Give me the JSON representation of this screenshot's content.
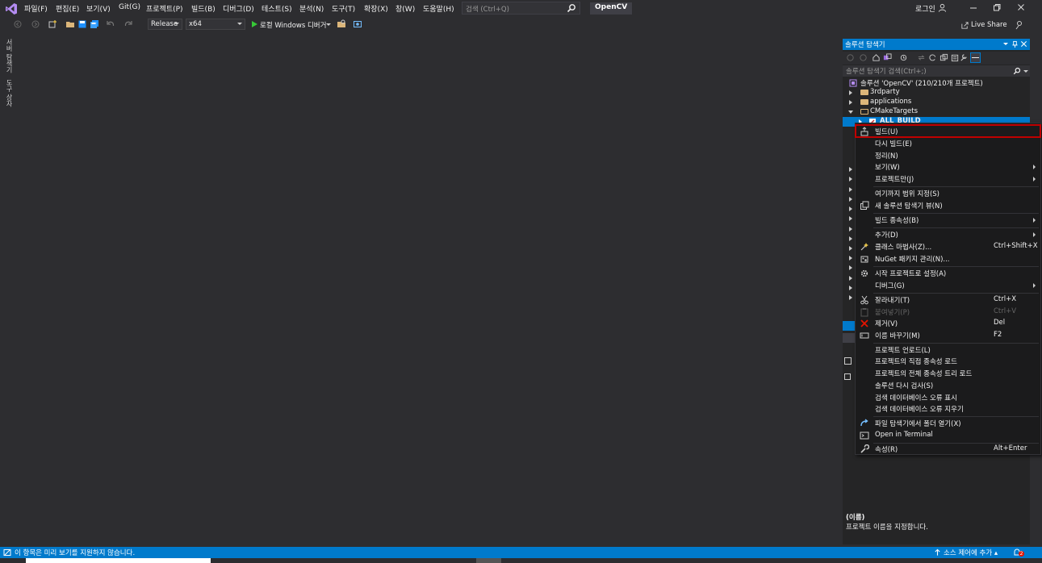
{
  "menu": {
    "items": [
      "파일(F)",
      "편집(E)",
      "보기(V)",
      "Git(G)",
      "프로젝트(P)",
      "빌드(B)",
      "디버그(D)",
      "테스트(S)",
      "분석(N)",
      "도구(T)",
      "확장(X)",
      "창(W)",
      "도움말(H)"
    ],
    "search_placeholder": "검색 (Ctrl+Q)",
    "solution_name": "OpenCV",
    "login": "로그인"
  },
  "toolbar": {
    "configuration": "Release",
    "platform": "x64",
    "debugger": "로컬 Windows 디버거",
    "live_share": "Live Share"
  },
  "left_tabs": [
    "서버 탐색기",
    "도구 상자"
  ],
  "solution_explorer": {
    "title": "솔루션 탐색기",
    "search_placeholder": "솔루션 탐색기 검색(Ctrl+;)",
    "tree": {
      "solution": "솔루션 'OpenCV' (210/210개 프로젝트)",
      "items": [
        "3rdparty",
        "applications",
        "CMakeTargets",
        "ALL_BUILD"
      ]
    }
  },
  "properties": {
    "description_title": "(이름)",
    "description": "프로젝트 이름을 지정합니다."
  },
  "context_menu": {
    "items": [
      {
        "label": "빌드(U)",
        "shortcut": "",
        "submenu": false,
        "disabled": false,
        "icon": "build-icon"
      },
      {
        "label": "다시 빌드(E)",
        "shortcut": "",
        "submenu": false,
        "disabled": false,
        "icon": ""
      },
      {
        "label": "정리(N)",
        "shortcut": "",
        "submenu": false,
        "disabled": false,
        "icon": ""
      },
      {
        "label": "보기(W)",
        "shortcut": "",
        "submenu": true,
        "disabled": false,
        "icon": ""
      },
      {
        "label": "프로젝트만(J)",
        "shortcut": "",
        "submenu": true,
        "disabled": false,
        "icon": ""
      },
      {
        "label": "여기까지 범위 지정(S)",
        "shortcut": "",
        "submenu": false,
        "disabled": false,
        "icon": ""
      },
      {
        "label": "새 솔루션 탐색기 뷰(N)",
        "shortcut": "",
        "submenu": false,
        "disabled": false,
        "icon": "new-view-icon"
      },
      {
        "label": "빌드 종속성(B)",
        "shortcut": "",
        "submenu": true,
        "disabled": false,
        "icon": ""
      },
      {
        "label": "추가(D)",
        "shortcut": "",
        "submenu": true,
        "disabled": false,
        "icon": ""
      },
      {
        "label": "클래스 마법사(Z)...",
        "shortcut": "Ctrl+Shift+X",
        "submenu": false,
        "disabled": false,
        "icon": "class-wizard-icon"
      },
      {
        "label": "NuGet 패키지 관리(N)...",
        "shortcut": "",
        "submenu": false,
        "disabled": false,
        "icon": "nuget-icon"
      },
      {
        "label": "시작 프로젝트로 설정(A)",
        "shortcut": "",
        "submenu": false,
        "disabled": false,
        "icon": "gear-icon"
      },
      {
        "label": "디버그(G)",
        "shortcut": "",
        "submenu": true,
        "disabled": false,
        "icon": ""
      },
      {
        "label": "잘라내기(T)",
        "shortcut": "Ctrl+X",
        "submenu": false,
        "disabled": false,
        "icon": "scissors-icon"
      },
      {
        "label": "붙여넣기(P)",
        "shortcut": "Ctrl+V",
        "submenu": false,
        "disabled": true,
        "icon": "paste-icon"
      },
      {
        "label": "제거(V)",
        "shortcut": "Del",
        "submenu": false,
        "disabled": false,
        "icon": "remove-icon"
      },
      {
        "label": "이름 바꾸기(M)",
        "shortcut": "F2",
        "submenu": false,
        "disabled": false,
        "icon": "rename-icon"
      },
      {
        "label": "프로젝트 언로드(L)",
        "shortcut": "",
        "submenu": false,
        "disabled": false,
        "icon": ""
      },
      {
        "label": "프로젝트의 직접 종속성 로드",
        "shortcut": "",
        "submenu": false,
        "disabled": false,
        "icon": ""
      },
      {
        "label": "프로젝트의 전체 종속성 트리 로드",
        "shortcut": "",
        "submenu": false,
        "disabled": false,
        "icon": ""
      },
      {
        "label": "솔루션 다시 검사(S)",
        "shortcut": "",
        "submenu": false,
        "disabled": false,
        "icon": ""
      },
      {
        "label": "검색 데이터베이스 오류 표시",
        "shortcut": "",
        "submenu": false,
        "disabled": false,
        "icon": ""
      },
      {
        "label": "검색 데이터베이스 오류 지우기",
        "shortcut": "",
        "submenu": false,
        "disabled": false,
        "icon": ""
      },
      {
        "label": "파일 탐색기에서 폴더 열기(X)",
        "shortcut": "",
        "submenu": false,
        "disabled": false,
        "icon": "open-folder-icon"
      },
      {
        "label": "Open in Terminal",
        "shortcut": "",
        "submenu": false,
        "disabled": false,
        "icon": "terminal-icon"
      },
      {
        "label": "속성(R)",
        "shortcut": "Alt+Enter",
        "submenu": false,
        "disabled": false,
        "icon": "wrench-icon"
      }
    ]
  },
  "status_bar": {
    "message": "이 항목은 미리 보기를 지원하지 않습니다.",
    "source_control": "소스 제어에 추가",
    "notification_count": "2"
  }
}
